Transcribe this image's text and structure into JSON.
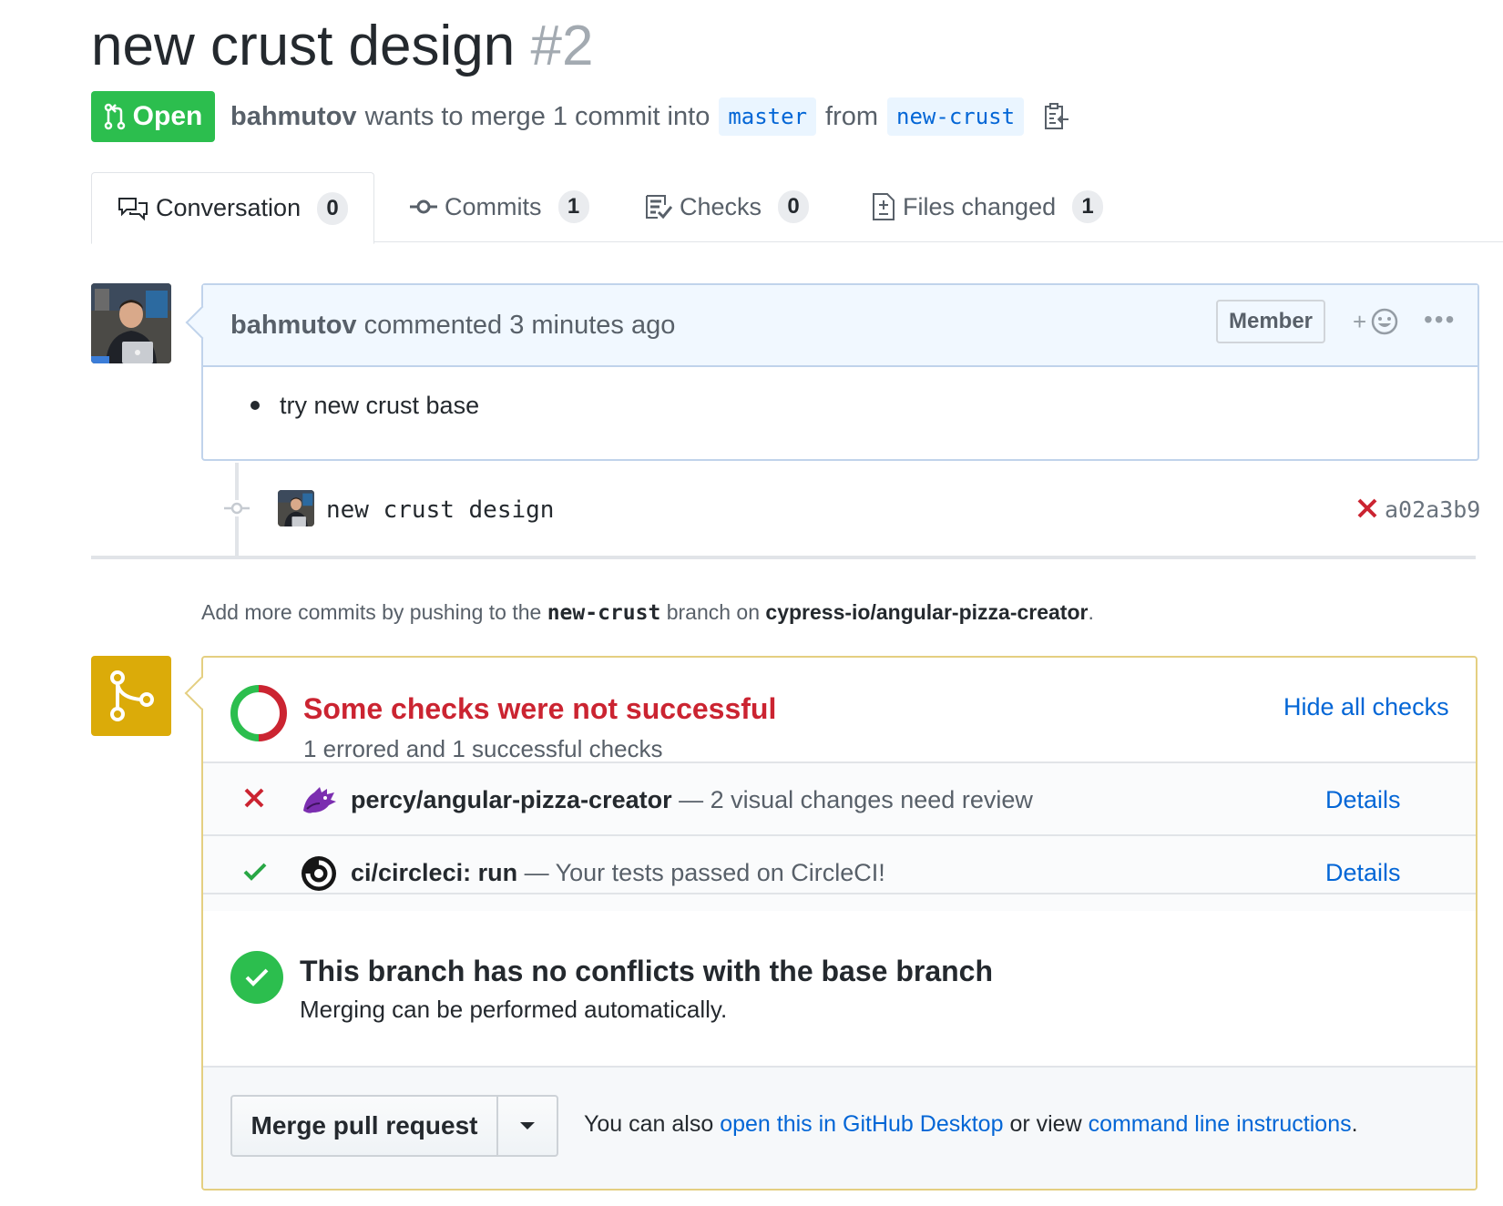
{
  "pr": {
    "title": "new crust design",
    "number": "#2",
    "state": "Open",
    "author": "bahmutov",
    "merge_text": "wants to merge 1 commit into",
    "base_branch": "master",
    "from_text": "from",
    "head_branch": "new-crust"
  },
  "tabs": [
    {
      "label": "Conversation",
      "count": "0",
      "icon": "comment-discussion-icon"
    },
    {
      "label": "Commits",
      "count": "1",
      "icon": "git-commit-icon"
    },
    {
      "label": "Checks",
      "count": "0",
      "icon": "checklist-icon"
    },
    {
      "label": "Files changed",
      "count": "1",
      "icon": "file-diff-icon"
    }
  ],
  "comment": {
    "author": "bahmutov",
    "action": "commented",
    "time": "3 minutes ago",
    "badge": "Member",
    "reaction": "+",
    "more": "•••",
    "bullet": "try new crust base"
  },
  "commit": {
    "message": "new crust design",
    "sha": "a02a3b9",
    "status": "failure"
  },
  "push_hint": {
    "prefix": "Add more commits by pushing to the",
    "branch": "new-crust",
    "middle": "branch on",
    "repo": "cypress-io/angular-pizza-creator",
    "suffix": "."
  },
  "checks": {
    "title": "Some checks were not successful",
    "subtitle": "1 errored and 1 successful checks",
    "hide_label": "Hide all checks",
    "items": [
      {
        "status": "error",
        "name": "percy/angular-pizza-creator",
        "desc": "— 2 visual changes need review",
        "details": "Details",
        "logo": "percy-logo"
      },
      {
        "status": "success",
        "name": "ci/circleci: run",
        "desc": "— Your tests passed on CircleCI!",
        "details": "Details",
        "logo": "circleci-logo"
      }
    ]
  },
  "merge": {
    "conflict_title": "This branch has no conflicts with the base branch",
    "conflict_sub": "Merging can be performed automatically.",
    "button": "Merge pull request",
    "hint_prefix": "You can also",
    "desktop_link": "open this in GitHub Desktop",
    "hint_middle": "or view",
    "cli_link": "command line instructions",
    "hint_suffix": "."
  },
  "colors": {
    "open_green": "#2cbe4e",
    "error_red": "#cb2431",
    "link_blue": "#0366d6",
    "merge_yellow": "#dbab09"
  }
}
